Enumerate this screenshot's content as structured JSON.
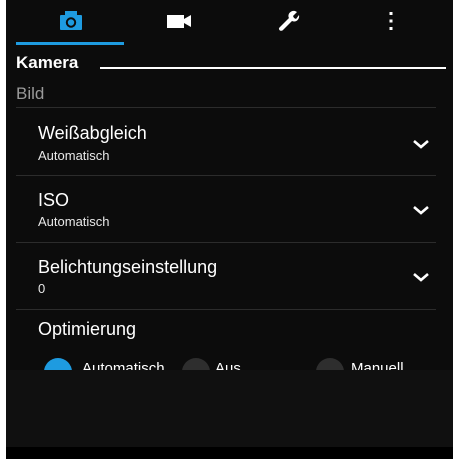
{
  "tabs": [
    {
      "name": "tab-camera",
      "icon": "camera-icon",
      "active": true
    },
    {
      "name": "tab-video",
      "icon": "video-camera-icon",
      "active": false
    },
    {
      "name": "tab-tools",
      "icon": "wrench-icon",
      "active": false
    },
    {
      "name": "tab-more",
      "icon": "more-vert-icon",
      "active": false
    }
  ],
  "header": {
    "title": "Kamera"
  },
  "section": {
    "label": "Bild"
  },
  "settings": [
    {
      "label": "Weißabgleich",
      "value": "Automatisch"
    },
    {
      "label": "ISO",
      "value": "Automatisch"
    },
    {
      "label": "Belichtungseinstellung",
      "value": "0"
    }
  ],
  "optimization": {
    "label": "Optimierung",
    "options": [
      {
        "label": "Automatisch",
        "selected": true
      },
      {
        "label": "Aus",
        "selected": false
      },
      {
        "label": "Manuell",
        "selected": false
      }
    ]
  },
  "colors": {
    "accent": "#1e9be0",
    "background": "#0c0c0c",
    "secondary_text": "#9a9a9a"
  }
}
